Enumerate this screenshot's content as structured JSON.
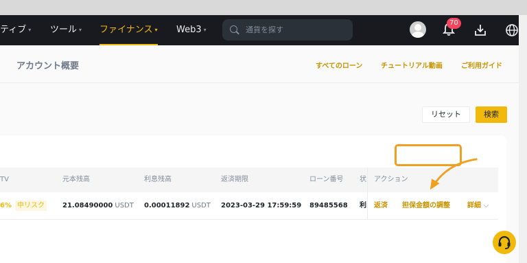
{
  "nav": {
    "items": [
      {
        "label": "ティブ",
        "caret": "▾"
      },
      {
        "label": "ツール",
        "caret": "▾"
      },
      {
        "label": "ファイナンス",
        "caret": "▾"
      },
      {
        "label": "Web3",
        "caret": "▾"
      }
    ],
    "active": "ファイナンス",
    "search_placeholder": "通貨を探す",
    "notification_count": "70"
  },
  "subheader": {
    "title": "アカウント概要",
    "links": [
      "すべてのローン",
      "チュートリアル動画",
      "ご利用ガイド"
    ]
  },
  "filters": {
    "reset_label": "リセット",
    "search_label": "検索"
  },
  "table": {
    "headers": [
      "TV",
      "元本残高",
      "利息残高",
      "返済期限",
      "ローン番号",
      "状",
      "アクション"
    ],
    "row": {
      "ltv": "6%",
      "risk": "中リスク",
      "principal": "21.08490000",
      "principal_unit": "USDT",
      "interest": "0.00011892",
      "interest_unit": "USDT",
      "due": "2023-03-29 17:59:59",
      "loan_id": "89485568",
      "status": "利",
      "actions": {
        "repay": "返済",
        "adjust": "担保金額の調整",
        "details": "詳細",
        "details_caret": "⌵"
      }
    }
  },
  "colors": {
    "accent": "#f0b90b",
    "nav_bg": "#181a20",
    "highlight": "#f0a020"
  },
  "icons": [
    "search-icon",
    "avatar-icon",
    "bell-icon",
    "download-icon",
    "globe-icon",
    "headset-icon",
    "arrow-icon"
  ]
}
